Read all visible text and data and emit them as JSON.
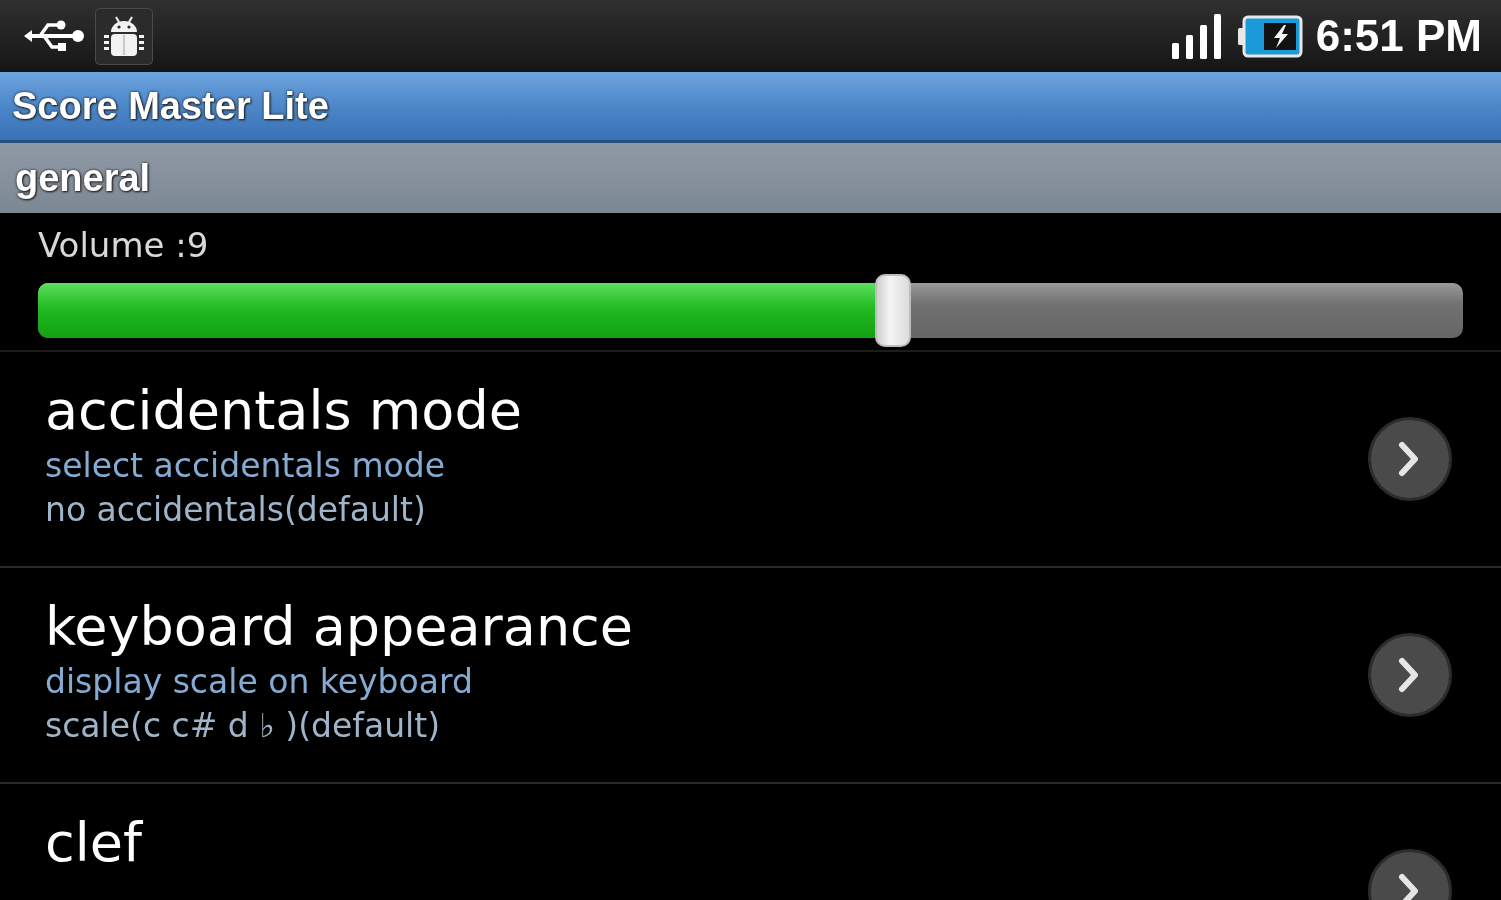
{
  "status_bar": {
    "time": "6:51 PM"
  },
  "app_bar": {
    "title": "Score Master Lite"
  },
  "section": {
    "title": "general"
  },
  "volume": {
    "label": "Volume :9",
    "level": 0.6
  },
  "preferences": [
    {
      "title": "accidentals mode",
      "summary": "select accidentals mode",
      "value": "no accidentals(default)"
    },
    {
      "title": "keyboard appearance",
      "summary": "display scale on keyboard",
      "value": "scale(c c# d ♭ )(default)"
    },
    {
      "title": "clef"
    }
  ]
}
